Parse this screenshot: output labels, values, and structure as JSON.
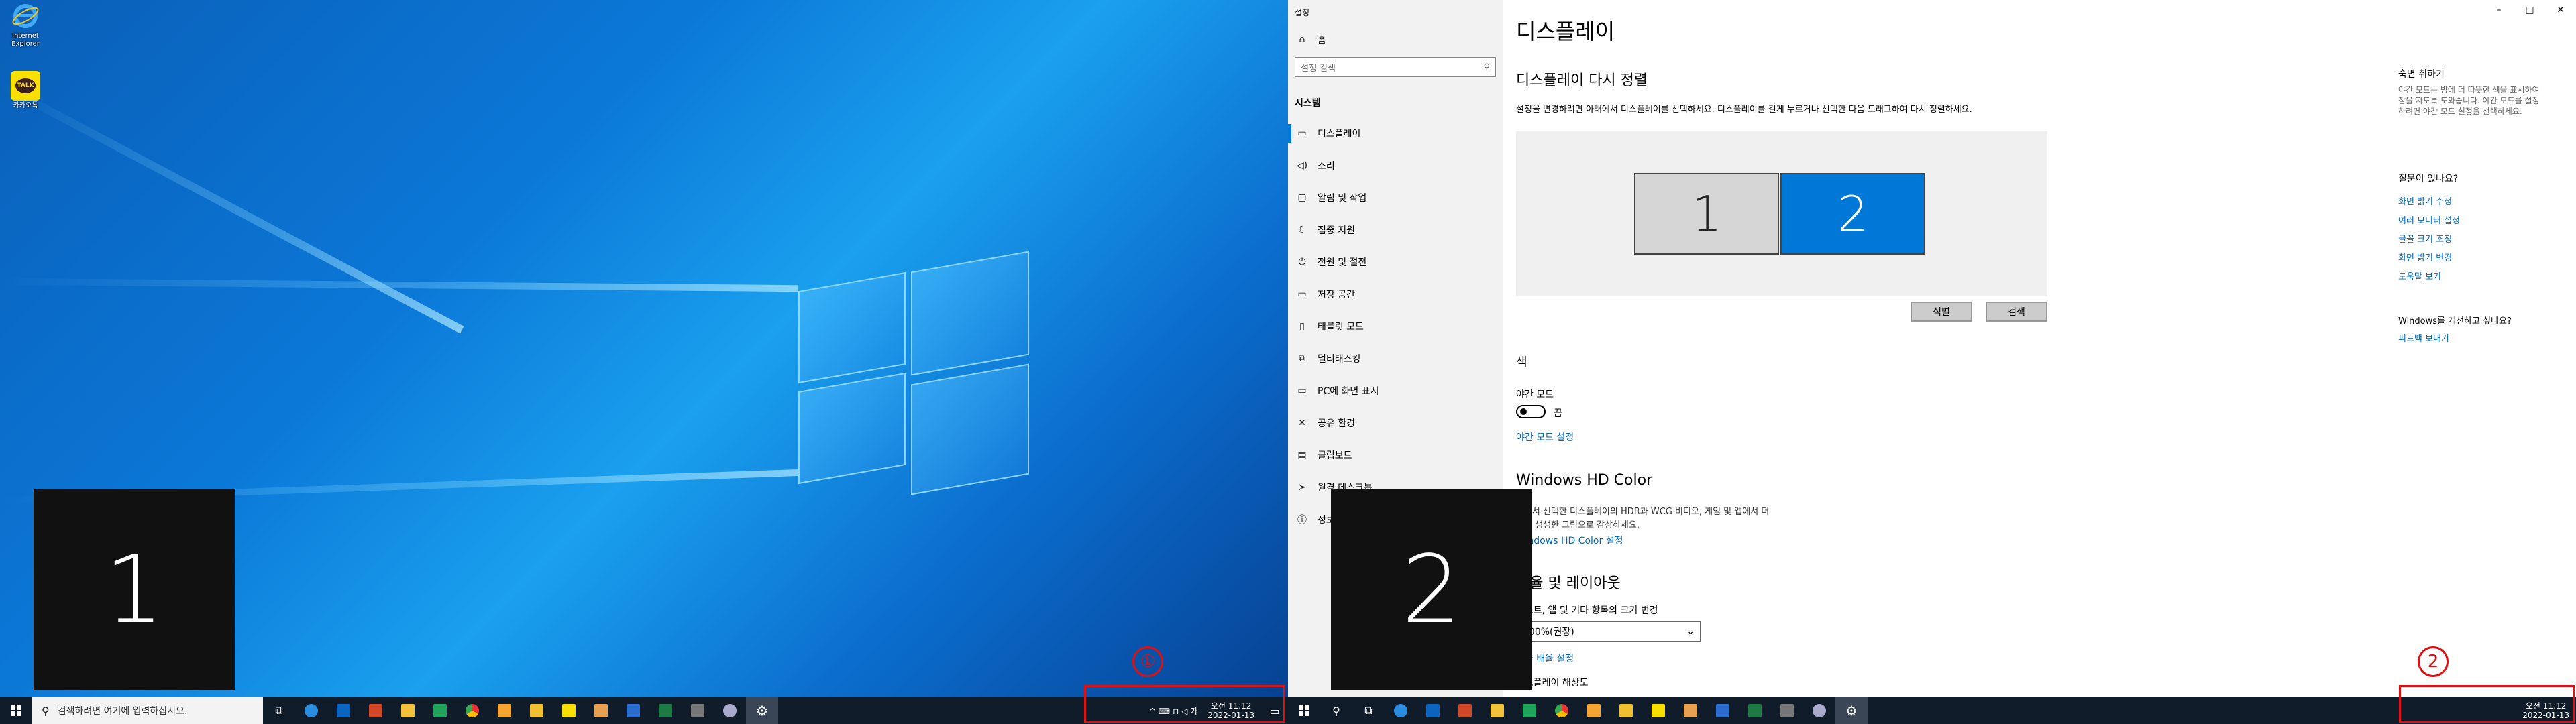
{
  "desktop1": {
    "icons": [
      {
        "label": "Internet Explorer",
        "icon": "internet-explorer-icon"
      },
      {
        "label": "카카오톡",
        "icon": "kakaotalk-icon"
      }
    ],
    "identify_number": "1",
    "annotation_number": "①"
  },
  "desktop2": {
    "identify_number": "2",
    "annotation_number": "2"
  },
  "taskbar1": {
    "search_placeholder": "검색하려면 여기에 입력하십시오.",
    "tray_icons": "^ ⌨ ⊓ ◁ 가",
    "clock_time": "오전 11:12",
    "clock_date": "2022-01-13"
  },
  "taskbar2": {
    "clock_time": "오전 11:12",
    "clock_date": "2022-01-13"
  },
  "settings": {
    "window_title": "설정",
    "home_label": "홈",
    "search_placeholder": "설정 검색",
    "section_label": "시스템",
    "nav": [
      {
        "label": "디스플레이",
        "icon": "monitor-icon",
        "glyph": "▭"
      },
      {
        "label": "소리",
        "icon": "speaker-icon",
        "glyph": "◁)"
      },
      {
        "label": "알림 및 작업",
        "icon": "notification-icon",
        "glyph": "▢"
      },
      {
        "label": "집중 지원",
        "icon": "focus-assist-icon",
        "glyph": "☾"
      },
      {
        "label": "전원 및 절전",
        "icon": "power-icon",
        "glyph": "⏻"
      },
      {
        "label": "저장 공간",
        "icon": "storage-icon",
        "glyph": "▭"
      },
      {
        "label": "태블릿 모드",
        "icon": "tablet-icon",
        "glyph": "▯"
      },
      {
        "label": "멀티태스킹",
        "icon": "multitasking-icon",
        "glyph": "⧉"
      },
      {
        "label": "PC에 화면 표시",
        "icon": "project-icon",
        "glyph": "▭"
      },
      {
        "label": "공유 환경",
        "icon": "shared-experiences-icon",
        "glyph": "✕"
      },
      {
        "label": "클립보드",
        "icon": "clipboard-icon",
        "glyph": "▤"
      },
      {
        "label": "원격 데스크톱",
        "icon": "remote-desktop-icon",
        "glyph": "≻"
      },
      {
        "label": "정보",
        "icon": "info-icon",
        "glyph": "ⓘ"
      }
    ],
    "page_title": "디스플레이",
    "rearrange_title": "디스플레이 다시 정렬",
    "rearrange_desc": "설정을 변경하려면 아래에서 디스플레이를 선택하세요. 디스플레이를 길게 누르거나 선택한 다음 드래그하여 다시 정렬하세요.",
    "display_1": "1",
    "display_2": "2",
    "identify_button": "식별",
    "detect_button": "검색",
    "color_title": "색",
    "night_light_label": "야간 모드",
    "night_light_state": "끔",
    "night_light_settings_link": "야간 모드 설정",
    "hdr_title": "Windows HD Color",
    "hdr_desc_1": "HDR과 WCG 비디오, 게임 및 앱에서 더",
    "hdr_desc_2": "하고 생생한 그림으로 감상하세요.",
    "hdr_desc_1_prefix": "이에서 선택한 디스플레이의",
    "hdr_link": "Windows HD Color 설정",
    "scale_title": "배율 및 레이아웃",
    "scale_label": "텍스트, 앱 및 기타 항목의 크기 변경",
    "scale_value": "100%(권장)",
    "advanced_scaling_link": "고급 배율 설정",
    "resolution_label": "디스플레이 해상도"
  },
  "side_panel": {
    "night_title": "숙면 취하기",
    "night_desc": "야간 모드는 밤에 더 따뜻한 색을 표시하여 잠을 자도록 도와줍니다. 야간 모드를 설정하려면 야간 모드 설정을 선택하세요.",
    "question_title": "질문이 있나요?",
    "links": [
      "화면 밝기 수정",
      "여러 모니터 설정",
      "글꼴 크기 조정",
      "화면 밝기 변경",
      "도움말 보기"
    ],
    "improve_title": "Windows를 개선하고 싶나요?",
    "feedback_link": "피드백 보내기"
  },
  "colors": {
    "accent": "#0078d7",
    "annotation_red": "#e01010",
    "taskbar": "#111c2a"
  }
}
